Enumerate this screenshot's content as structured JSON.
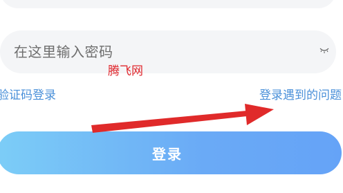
{
  "password_field": {
    "placeholder": "在这里输入密码",
    "eye_icon": "eye-closed-icon"
  },
  "watermark": {
    "text": "腾飞网",
    "color": "#e0262c"
  },
  "links": {
    "sms_login": "验证码登录",
    "login_problems": "登录遇到的问题"
  },
  "login_button": {
    "label": "登录",
    "gradient_start": "#7ccdf7",
    "gradient_end": "#65a3f7"
  },
  "annotation": {
    "icon": "red-arrow-icon",
    "color": "#e02a2a"
  },
  "colors": {
    "link": "#4a90d9",
    "field_background": "#f4f5f7",
    "placeholder": "#6e6e6e"
  }
}
